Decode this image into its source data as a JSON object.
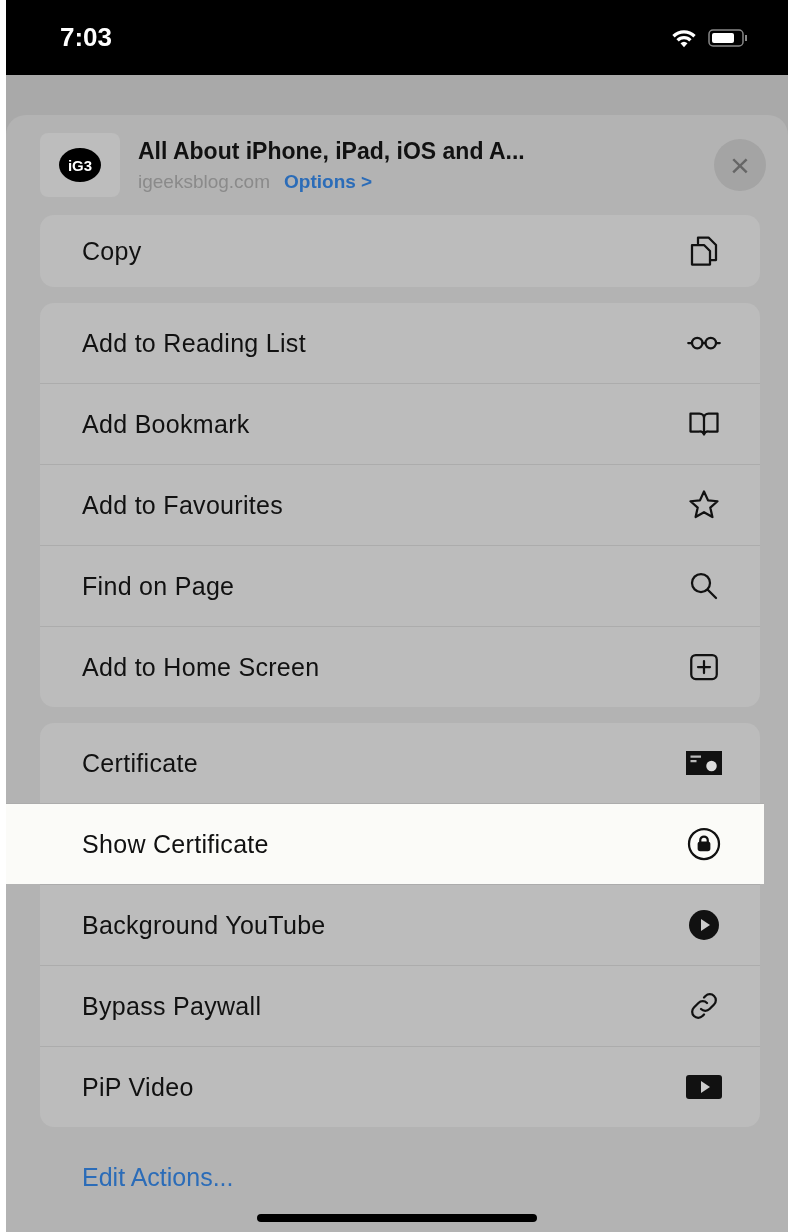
{
  "status_bar": {
    "time": "7:03"
  },
  "header": {
    "logo": "iG3",
    "title": "All About iPhone, iPad, iOS and A...",
    "domain": "igeeksblog.com",
    "options": "Options >",
    "close": "×"
  },
  "groups": [
    {
      "rows": [
        {
          "label": "Copy",
          "kind": "copy",
          "selected": false
        }
      ]
    },
    {
      "rows": [
        {
          "label": "Add to Reading List",
          "kind": "glasses",
          "selected": false
        },
        {
          "label": "Add Bookmark",
          "kind": "book",
          "selected": false
        },
        {
          "label": "Add to Favourites",
          "kind": "star",
          "selected": false
        },
        {
          "label": "Find on Page",
          "kind": "search",
          "selected": false
        },
        {
          "label": "Add to Home Screen",
          "kind": "plus",
          "selected": false
        }
      ]
    },
    {
      "rows": [
        {
          "label": "Certificate",
          "kind": "certificate",
          "selected": false
        },
        {
          "label": "Show Certificate",
          "kind": "lock",
          "selected": true
        },
        {
          "label": "Background YouTube",
          "kind": "play",
          "selected": false
        },
        {
          "label": "Bypass Paywall",
          "kind": "link",
          "selected": false
        },
        {
          "label": "PiP Video",
          "kind": "video",
          "selected": false
        }
      ]
    }
  ],
  "edit_actions": "Edit Actions..."
}
